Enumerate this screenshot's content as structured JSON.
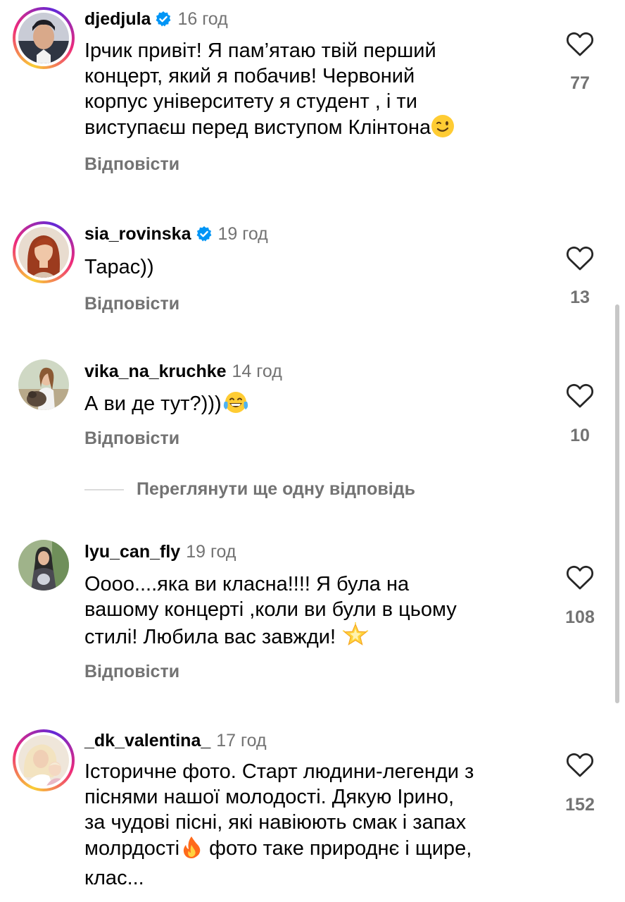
{
  "comments": [
    {
      "username": "djedjula",
      "verified": true,
      "time": "16 год",
      "lines": [
        "Ірчик привіт! Я пам’ятаю твій перший",
        "концерт, який я побачив! Червоний",
        "корпус університету я студент , і ти",
        "виступаєш перед виступом Клінтона"
      ],
      "emoji": "winking-face",
      "reply_label": "Відповісти",
      "likes": "77",
      "story_ring": true
    },
    {
      "username": "sia_rovinska",
      "verified": true,
      "time": "19 год",
      "lines": [
        "Тарас))"
      ],
      "reply_label": "Відповісти",
      "likes": "13",
      "story_ring": true
    },
    {
      "username": "vika_na_kruchke",
      "verified": false,
      "time": "14 год",
      "lines": [
        "А ви де тут?)))"
      ],
      "emoji": "tears-of-joy",
      "reply_label": "Відповісти",
      "likes": "10",
      "story_ring": false
    },
    {
      "username": "lyu_can_fly",
      "verified": false,
      "time": "19 год",
      "lines": [
        "Оооо....яка ви класна!!!! Я була на",
        "вашому концерті ,коли ви були в цьому",
        "стилі! Любила вас завжди!"
      ],
      "emoji": "glowing-star",
      "reply_label": "Відповісти",
      "likes": "108",
      "story_ring": false
    },
    {
      "username": "_dk_valentina_",
      "verified": false,
      "time": "17 год",
      "lines": [
        "Історичне фото. Старт людини-легенди з",
        "піснями нашої молодості. Дякую Ірино,",
        "за чудові пісні, які навіюють смак і запах",
        "молрдості",
        "клас..."
      ],
      "line4_rest": "фото таке природнє і щире,",
      "emoji": "fire",
      "likes": "152",
      "story_ring": true
    }
  ],
  "view_more_replies": "Переглянути ще одну відповідь",
  "colors": {
    "secondary_text": "#737373",
    "verified_blue": "#0095f6",
    "divider": "#dbdbdb"
  }
}
